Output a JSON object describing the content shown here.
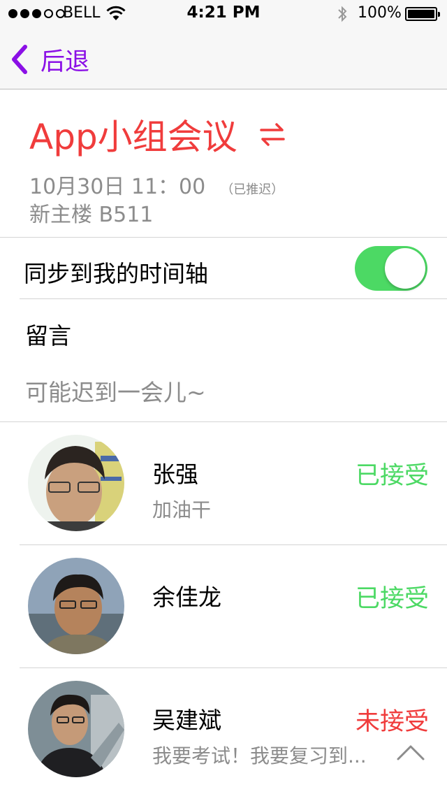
{
  "status_bar": {
    "carrier": "BELL",
    "time": "4:21 PM",
    "battery_percent": "100%",
    "signal_strength": 3,
    "icons": [
      "signal-dots-icon",
      "wifi-icon",
      "bluetooth-icon",
      "battery-icon"
    ]
  },
  "nav": {
    "back_label": "后退",
    "accent_color": "#8b10e6"
  },
  "event": {
    "title": "App小组会议",
    "datetime": "10月30日 11：00",
    "status": "（已推迟）",
    "location": "新主楼 B511",
    "title_color": "#f03c3c",
    "swap_icon": "swap-arrows-icon"
  },
  "sync": {
    "label": "同步到我的时间轴",
    "enabled": true,
    "on_color": "#4cd964"
  },
  "message": {
    "label": "留言",
    "text": "可能迟到一会儿~"
  },
  "attendees": [
    {
      "name": "张强",
      "note": "加油干",
      "status": "已接受",
      "status_color": "#4cd964"
    },
    {
      "name": "余佳龙",
      "note": "",
      "status": "已接受",
      "status_color": "#4cd964"
    },
    {
      "name": "吴建斌",
      "note": "我要考试！我要复习到...",
      "status": "未接受",
      "status_color": "#f03c3c"
    }
  ]
}
